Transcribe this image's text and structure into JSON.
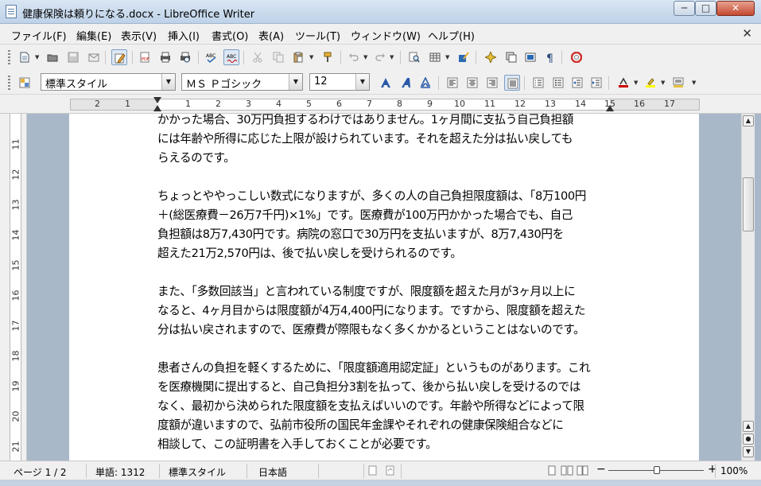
{
  "window": {
    "title": "健康保険は頼りになる.docx - LibreOffice Writer",
    "minimize_glyph": "─",
    "maximize_glyph": "□",
    "close_glyph": "✕"
  },
  "menu": {
    "items": [
      "ファイル(F)",
      "編集(E)",
      "表示(V)",
      "挿入(I)",
      "書式(O)",
      "表(A)",
      "ツール(T)",
      "ウィンドウ(W)",
      "ヘルプ(H)"
    ],
    "close_doc": "✕"
  },
  "formatting": {
    "paragraph_style": "標準スタイル",
    "font_name": "ＭＳ Ｐゴシック",
    "font_size": "12"
  },
  "ruler": {
    "horizontal_labels": [
      "2",
      "1",
      "1",
      "2",
      "3",
      "4",
      "5",
      "6",
      "7",
      "8",
      "9",
      "10",
      "11",
      "12",
      "13",
      "14",
      "15",
      "16",
      "17"
    ],
    "vertical_labels": [
      "11",
      "12",
      "13",
      "14",
      "15",
      "16",
      "17",
      "18",
      "19",
      "20",
      "21"
    ]
  },
  "document": {
    "paragraphs": [
      "かかった場合、30万円負担するわけではありません。1ヶ月間に支払う自己負担額\nには年齢や所得に応じた上限が設けられています。それを超えた分は払い戻しても\nらえるのです。",
      "ちょっとややっこしい数式になりますが、多くの人の自己負担限度額は、「8万100円\n＋(総医療費－26万7千円)×1%」です。医療費が100万円かかった場合でも、自己\n負担額は8万7,430円です。病院の窓口で30万円を支払いますが、8万7,430円を\n超えた21万2,570円は、後で払い戻しを受けられるのです。",
      "また、「多数回該当」と言われている制度ですが、限度額を超えた月が3ヶ月以上に\nなると、4ヶ月目からは限度額が4万4,400円になります。ですから、限度額を超えた\n分は払い戻されますので、医療費が際限もなく多くかかるということはないのです。",
      "患者さんの負担を軽くするために、「限度額適用認定証」というものがあります。これ\nを医療機関に提出すると、自己負担分3割を払って、後から払い戻しを受けるのでは\nなく、最初から決められた限度額を支払えばいいのです。年齢や所得などによって限\n度額が違いますので、弘前市役所の国民年金課やそれぞれの健康保険組合などに\n相談して、この証明書を入手しておくことが必要です。"
    ]
  },
  "status": {
    "page": "ページ 1 / 2",
    "words": "単語: 1312",
    "style": "標準スタイル",
    "language": "日本語",
    "zoom": "100%",
    "zoom_minus": "−",
    "zoom_plus": "+"
  },
  "colors": {
    "titlebar": "#bed2e8",
    "accent": "#2a6ab5",
    "page_bg": "#ffffff",
    "workspace": "#a9b8c9"
  }
}
